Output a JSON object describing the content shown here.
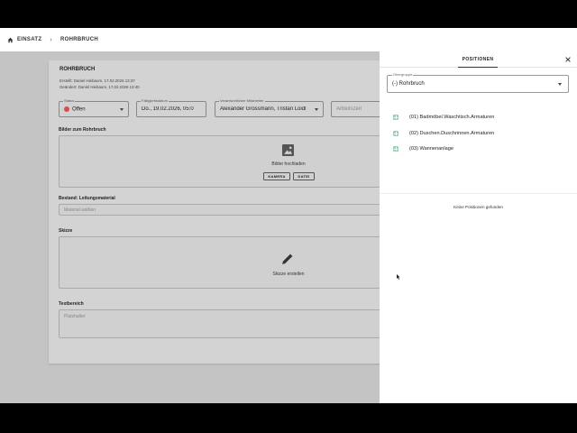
{
  "breadcrumb": {
    "home": "EINSATZ",
    "current": "ROHRBRUCH"
  },
  "card": {
    "title": "ROHRBRUCH",
    "created": "Erstellt: Daniel Hiebaum, 17.02.2026 13:37",
    "changed": "Geändert: Daniel Hiebaum, 17.02.2026 13:40",
    "status": {
      "label": "Status",
      "value": "Offen",
      "color": "#d94b4b"
    },
    "due": {
      "label": "Fälligkeitsdatum",
      "value": "Do., 19.02.2026, 05:0"
    },
    "responsible": {
      "label": "Verantwortlicher Mitarbeiter",
      "value": "Alexander Grossmann, Tristan Loidl"
    },
    "worktime": {
      "placeholder": "Arbeitszeit"
    },
    "images": {
      "heading": "Bilder zum Rohrbruch",
      "upload": "Bilder hochladen",
      "camera": "KAMERA",
      "file": "DATEI"
    },
    "material": {
      "heading": "Bestand: Leitungsmaterial",
      "placeholder": "Material wählen"
    },
    "sketch": {
      "heading": "Skizze",
      "action": "Skizze erstellen"
    },
    "text": {
      "heading": "Textbereich",
      "placeholder": "Platzhalter"
    }
  },
  "panel": {
    "tab": "POSITIONEN",
    "group": {
      "label": "Obergruppe",
      "value": "(-) Rohrbruch"
    },
    "items": [
      "(01) Badmöbel.Waschtisch.Armaturen",
      "(02) Duschen.Duschrinnen.Armaturen",
      "(03) Wannenanlage"
    ],
    "empty": "Keine Positionen gefunden"
  }
}
